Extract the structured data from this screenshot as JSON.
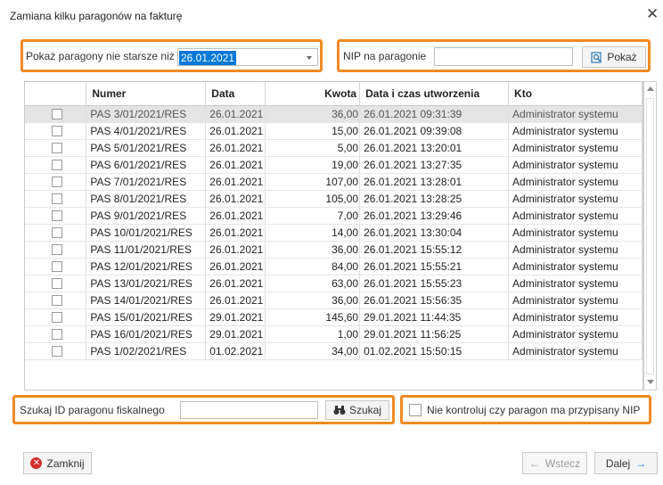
{
  "window": {
    "title": "Zamiana kilku paragonów na fakturę",
    "close_glyph": "✕"
  },
  "filter": {
    "label": "Pokaż paragony nie starsze niż",
    "date_value": "26.01.2021"
  },
  "nip": {
    "label": "NIP na paragonie",
    "value": "",
    "show_button": "Pokaż"
  },
  "table": {
    "headers": {
      "number": "Numer",
      "date": "Data",
      "amount": "Kwota",
      "created": "Data i czas utworzenia",
      "who": "Kto"
    },
    "rows": [
      {
        "number": "PAS 3/01/2021/RES",
        "date": "26.01.2021",
        "amount": "36,00",
        "created": "26.01.2021 09:31:39",
        "who": "Administrator systemu"
      },
      {
        "number": "PAS 4/01/2021/RES",
        "date": "26.01.2021",
        "amount": "15,00",
        "created": "26.01.2021 09:39:08",
        "who": "Administrator systemu"
      },
      {
        "number": "PAS 5/01/2021/RES",
        "date": "26.01.2021",
        "amount": "5,00",
        "created": "26.01.2021 13:20:01",
        "who": "Administrator systemu"
      },
      {
        "number": "PAS 6/01/2021/RES",
        "date": "26.01.2021",
        "amount": "19,00",
        "created": "26.01.2021 13:27:35",
        "who": "Administrator systemu"
      },
      {
        "number": "PAS 7/01/2021/RES",
        "date": "26.01.2021",
        "amount": "107,00",
        "created": "26.01.2021 13:28:01",
        "who": "Administrator systemu"
      },
      {
        "number": "PAS 8/01/2021/RES",
        "date": "26.01.2021",
        "amount": "105,00",
        "created": "26.01.2021 13:28:25",
        "who": "Administrator systemu"
      },
      {
        "number": "PAS 9/01/2021/RES",
        "date": "26.01.2021",
        "amount": "7,00",
        "created": "26.01.2021 13:29:46",
        "who": "Administrator systemu"
      },
      {
        "number": "PAS 10/01/2021/RES",
        "date": "26.01.2021",
        "amount": "14,00",
        "created": "26.01.2021 13:30:04",
        "who": "Administrator systemu"
      },
      {
        "number": "PAS 11/01/2021/RES",
        "date": "26.01.2021",
        "amount": "36,00",
        "created": "26.01.2021 15:55:12",
        "who": "Administrator systemu"
      },
      {
        "number": "PAS 12/01/2021/RES",
        "date": "26.01.2021",
        "amount": "84,00",
        "created": "26.01.2021 15:55:21",
        "who": "Administrator systemu"
      },
      {
        "number": "PAS 13/01/2021/RES",
        "date": "26.01.2021",
        "amount": "63,00",
        "created": "26.01.2021 15:55:23",
        "who": "Administrator systemu"
      },
      {
        "number": "PAS 14/01/2021/RES",
        "date": "26.01.2021",
        "amount": "36,00",
        "created": "26.01.2021 15:56:35",
        "who": "Administrator systemu"
      },
      {
        "number": "PAS 15/01/2021/RES",
        "date": "29.01.2021",
        "amount": "145,60",
        "created": "29.01.2021 11:44:35",
        "who": "Administrator systemu"
      },
      {
        "number": "PAS 16/01/2021/RES",
        "date": "29.01.2021",
        "amount": "1,00",
        "created": "29.01.2021 11:56:25",
        "who": "Administrator systemu"
      },
      {
        "number": "PAS 1/02/2021/RES",
        "date": "01.02.2021",
        "amount": "34,00",
        "created": "01.02.2021 15:50:15",
        "who": "Administrator systemu"
      }
    ]
  },
  "search": {
    "label": "Szukaj ID paragonu fiskalnego",
    "value": "",
    "button": "Szukaj"
  },
  "nip_check": {
    "label": "Nie kontroluj czy paragon ma przypisany NIP",
    "checked": false
  },
  "footer": {
    "close": "Zamknij",
    "back": "Wstecz",
    "next": "Dalej"
  },
  "colors": {
    "highlight": "#f08a24",
    "selection": "#0078d7",
    "close_icon": "#d32f2f",
    "next_arrow": "#1a73e8"
  }
}
